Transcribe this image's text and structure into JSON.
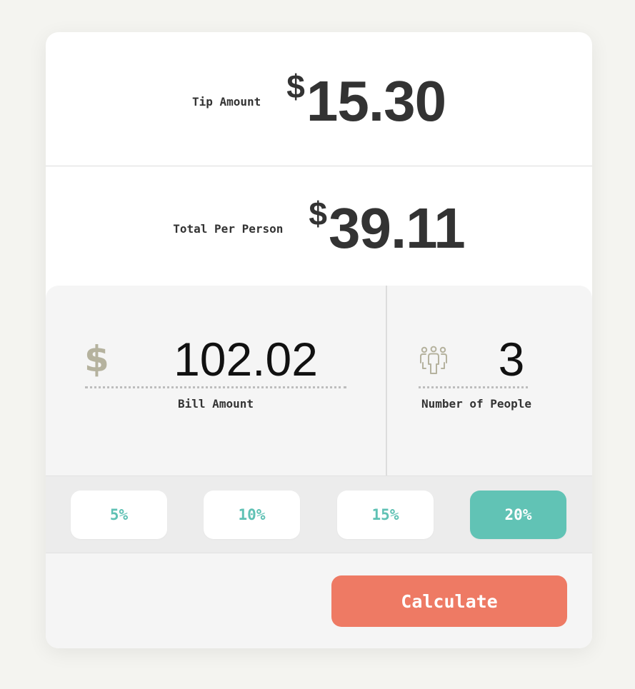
{
  "results": {
    "tip": {
      "label": "Tip Amount",
      "currency": "$",
      "value": "15.30"
    },
    "total": {
      "label": "Total Per Person",
      "currency": "$",
      "value": "39.11"
    }
  },
  "inputs": {
    "bill": {
      "icon": "dollar-icon",
      "symbol": "$",
      "value": "102.02",
      "label": "Bill Amount"
    },
    "people": {
      "icon": "people-group-icon",
      "value": "3",
      "label": "Number of People"
    }
  },
  "tip_options": [
    {
      "label": "5%",
      "selected": false
    },
    {
      "label": "10%",
      "selected": false
    },
    {
      "label": "15%",
      "selected": false
    },
    {
      "label": "20%",
      "selected": true
    }
  ],
  "actions": {
    "calculate_label": "Calculate"
  },
  "colors": {
    "background": "#f4f4f0",
    "card": "#ffffff",
    "panel": "#f5f5f5",
    "accent_teal": "#61c3b5",
    "accent_coral": "#ee7a64",
    "icon_muted": "#b5b29e",
    "text_dark": "#333333"
  }
}
